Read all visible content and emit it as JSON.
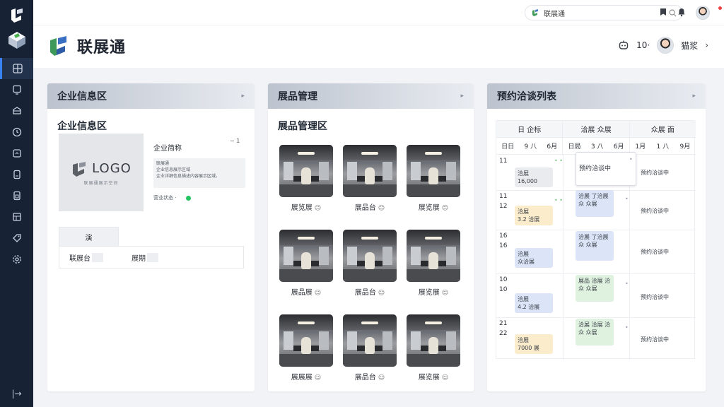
{
  "topbar": {
    "search_value": "联展通",
    "icons": [
      "search-icon",
      "bookmark-icon",
      "bell-icon",
      "user-avatar"
    ]
  },
  "header": {
    "brand": "联展通",
    "count": "10·",
    "username": "猫浆",
    "chevron": "›"
  },
  "sidebar": {
    "items": [
      "dashboard-icon",
      "monitor-icon",
      "box-icon",
      "clock-icon",
      "calendar-icon",
      "file-icon",
      "document-icon",
      "table-icon",
      "tag-icon",
      "settings-icon"
    ],
    "collapse": "|→"
  },
  "enterprise": {
    "panel_title": "企业信息区",
    "sub_title": "企业信息区",
    "logo_text": "LOGO",
    "logo_sub": "联展通展示空间",
    "name": "企业简称",
    "desc_lines": [
      "联展通",
      "企业信息展示区域",
      "企业详细信息描述内容展示区域。"
    ],
    "status": "营业状态 ·",
    "minus": "− 1",
    "tab": "演",
    "row_label": "联展台",
    "row_label2": "展期"
  },
  "products": {
    "panel_title": "展品管理",
    "sub_title": "展品管理区",
    "items": [
      {
        "label": "展览展"
      },
      {
        "label": "展品台"
      },
      {
        "label": "展览展"
      },
      {
        "label": "展品展"
      },
      {
        "label": "展品台"
      },
      {
        "label": "展览展"
      },
      {
        "label": "展展展"
      },
      {
        "label": "展品台"
      },
      {
        "label": "展览展"
      }
    ]
  },
  "schedule": {
    "panel_title": "预约洽谈列表",
    "col_headers": [
      "日 企标",
      "洽展 众展",
      "众展 面"
    ],
    "sub_headers": [
      [
        "日日",
        "9 八",
        "6月"
      ],
      [
        "日局",
        "3 八",
        "6月"
      ],
      [
        "1月",
        "1 八",
        "9月"
      ]
    ],
    "time_rows": [
      [
        "11"
      ],
      [
        "11",
        "12"
      ],
      [
        "16",
        "16"
      ],
      [
        "10",
        "10"
      ],
      [
        "21",
        "22"
      ]
    ],
    "row_tail": "预约洽谈中",
    "chips": {
      "r1c1": "洽展\n16,000",
      "r1c2": "预约洽谈中",
      "r2c1": "洽展\n3.2 洽展",
      "r2c2": "洽展 了洽展\n众 众展",
      "r3c1": "洽展\n众洽展",
      "r3c2": "洽展 了洽展\n众 众展",
      "r4c1": "洽展\n4.2 洽展",
      "r4c2": "展品 洽展 洽\n众 众展",
      "r5c1": "洽展\n7000 展",
      "r5c2": "洽展 洽展 洽\n众 众展"
    }
  }
}
